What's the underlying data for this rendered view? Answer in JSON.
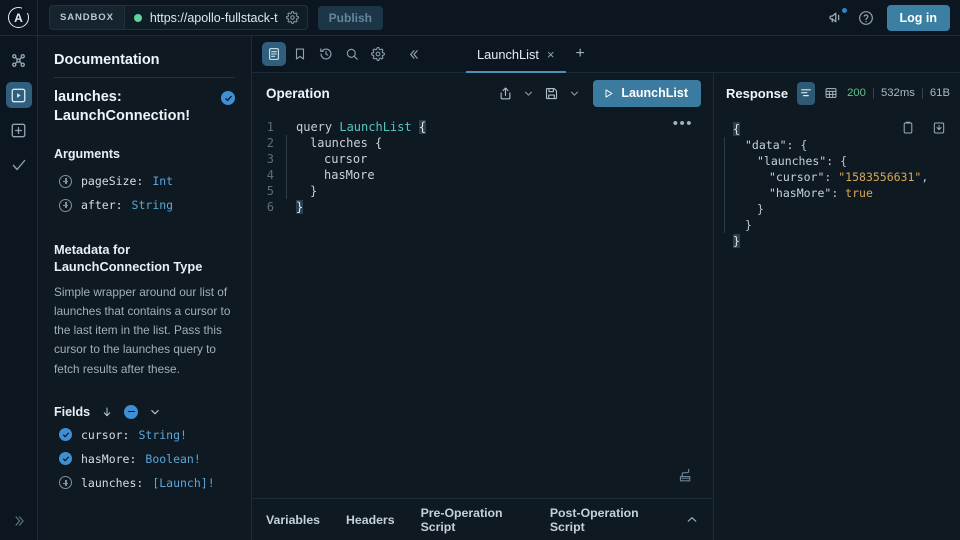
{
  "topbar": {
    "logo_letter": "A",
    "logo_name": "apollo-logo-icon",
    "sandbox_label": "SANDBOX",
    "endpoint_url": "https://apollo-fullstack-t",
    "endpoint_settings_icon": "gear-icon",
    "status": "connected",
    "publish_label": "Publish",
    "announcements_icon": "megaphone-icon",
    "help_icon": "help-circle-icon",
    "login_label": "Log in"
  },
  "rail": {
    "items": [
      {
        "name": "schema-graph",
        "icon": "graph-icon",
        "active": false
      },
      {
        "name": "explorer",
        "icon": "play-box-icon",
        "active": true
      },
      {
        "name": "add-operation",
        "icon": "plus-box-icon",
        "active": false
      },
      {
        "name": "checks",
        "icon": "check-icon",
        "active": false
      }
    ],
    "collapse_icon": "chevron-double-right-icon"
  },
  "docs_toolbar": {
    "items": [
      {
        "name": "documentation",
        "icon": "document-icon",
        "active": true
      },
      {
        "name": "saved-operations",
        "icon": "bookmark-icon",
        "active": false
      },
      {
        "name": "history",
        "icon": "history-icon",
        "active": false
      },
      {
        "name": "search",
        "icon": "search-icon",
        "active": false
      },
      {
        "name": "settings",
        "icon": "gear-icon",
        "active": false
      }
    ],
    "collapse_label": "«"
  },
  "docs": {
    "title": "Documentation",
    "field_name": "launches: LaunchConnection!",
    "field_selected": true,
    "arguments_title": "Arguments",
    "arguments": [
      {
        "name": "pageSize:",
        "type": "Int"
      },
      {
        "name": "after:",
        "type": "String"
      }
    ],
    "metadata_title": "Metadata for LaunchConnection Type",
    "metadata_description": "Simple wrapper around our list of launches that contains a cursor to the last item in the list. Pass this cursor to the launches query to fetch results after these.",
    "fields_label": "Fields",
    "fields_sort_icon": "arrow-down-icon",
    "fields_select_state": "partial",
    "fields_chevron_icon": "chevron-down-icon",
    "fields": [
      {
        "name": "cursor:",
        "type": "String!",
        "selected": true
      },
      {
        "name": "hasMore:",
        "type": "Boolean!",
        "selected": true
      },
      {
        "name": "launches:",
        "type": "[Launch]!",
        "selected": false
      }
    ]
  },
  "tabs": {
    "items": [
      {
        "label": "LaunchList",
        "active": true
      }
    ],
    "close_label": "×",
    "add_label": "+"
  },
  "operation": {
    "title": "Operation",
    "share_icon": "share-icon",
    "save_icon": "save-icon",
    "chevron_icon": "chevron-down-icon",
    "run_label": "LaunchList",
    "run_icon": "play-icon",
    "more_label": "•••",
    "format_icon": "format-brush-icon",
    "code": [
      {
        "num": "1",
        "tokens": [
          {
            "t": "query ",
            "c": "kw"
          },
          {
            "t": "LaunchList",
            "c": "opname"
          },
          {
            "t": " ",
            "c": "kw"
          },
          {
            "t": "{",
            "c": "brace-hl"
          }
        ],
        "bar": false
      },
      {
        "num": "2",
        "tokens": [
          {
            "t": "launches {",
            "c": "fieldn"
          }
        ],
        "bar": true,
        "indent": 1
      },
      {
        "num": "3",
        "tokens": [
          {
            "t": "cursor",
            "c": "fieldn"
          }
        ],
        "bar": true,
        "indent": 2
      },
      {
        "num": "4",
        "tokens": [
          {
            "t": "hasMore",
            "c": "fieldn"
          }
        ],
        "bar": true,
        "indent": 2
      },
      {
        "num": "5",
        "tokens": [
          {
            "t": "}",
            "c": "brace"
          }
        ],
        "bar": true,
        "indent": 1
      },
      {
        "num": "6",
        "tokens": [
          {
            "t": "}",
            "c": "brace-hl"
          }
        ],
        "bar": false
      }
    ],
    "bottom_tabs": [
      "Variables",
      "Headers",
      "Pre-Operation Script",
      "Post-Operation Script"
    ],
    "collapse_icon": "chevron-up-icon"
  },
  "response": {
    "title": "Response",
    "view_json_icon": "json-view-icon",
    "view_table_icon": "table-view-icon",
    "status_code": "200",
    "duration": "532ms",
    "size": "61B",
    "copy_icon": "clipboard-icon",
    "download_icon": "download-icon",
    "json": [
      {
        "indent": 0,
        "bar": false,
        "tokens": [
          {
            "t": "{",
            "c": "j-brace-hl"
          }
        ]
      },
      {
        "indent": 1,
        "bar": true,
        "tokens": [
          {
            "t": "\"data\"",
            "c": "j-key"
          },
          {
            "t": ": {",
            "c": "j-punc"
          }
        ]
      },
      {
        "indent": 2,
        "bar": true,
        "tokens": [
          {
            "t": "\"launches\"",
            "c": "j-key"
          },
          {
            "t": ": {",
            "c": "j-punc"
          }
        ]
      },
      {
        "indent": 3,
        "bar": true,
        "tokens": [
          {
            "t": "\"cursor\"",
            "c": "j-key"
          },
          {
            "t": ": ",
            "c": "j-punc"
          },
          {
            "t": "\"1583556631\"",
            "c": "j-str"
          },
          {
            "t": ",",
            "c": "j-punc"
          }
        ]
      },
      {
        "indent": 3,
        "bar": true,
        "tokens": [
          {
            "t": "\"hasMore\"",
            "c": "j-key"
          },
          {
            "t": ": ",
            "c": "j-punc"
          },
          {
            "t": "true",
            "c": "j-bool"
          }
        ]
      },
      {
        "indent": 2,
        "bar": true,
        "tokens": [
          {
            "t": "}",
            "c": "j-punc"
          }
        ]
      },
      {
        "indent": 1,
        "bar": true,
        "tokens": [
          {
            "t": "}",
            "c": "j-punc"
          }
        ]
      },
      {
        "indent": 0,
        "bar": false,
        "tokens": [
          {
            "t": "}",
            "c": "j-brace-hl"
          }
        ]
      }
    ]
  },
  "colors": {
    "accent": "#3b7fa3",
    "brand_blue": "#3f8fd4",
    "status_green": "#63c08d",
    "bg": "#0e1922",
    "panel": "#0b1620"
  }
}
